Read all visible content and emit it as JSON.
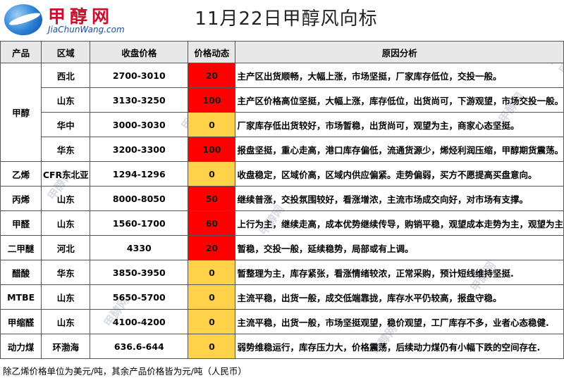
{
  "brand": {
    "name_cn": "甲醇网",
    "domain": "JiaChunWang.com"
  },
  "title": "11月22日甲醇风向标",
  "table": {
    "headers": [
      "产品",
      "区域",
      "收盘价格",
      "价格动态",
      "原因分析"
    ],
    "groups": [
      {
        "product": "甲醇",
        "rows": [
          {
            "region": "西北",
            "price": "2700-3010",
            "change": "20",
            "status": "up",
            "reason": "主产区出货顺畅，大幅上涨，市场坚挺，厂家库存低位，交投一般。"
          },
          {
            "region": "山东",
            "price": "3130-3250",
            "change": "100",
            "status": "up",
            "reason": "主产区价格高位坚挺，大幅上涨，库存低位，出货尚可，下游观望，市场交投一般。"
          },
          {
            "region": "华中",
            "price": "3000-3030",
            "change": "0",
            "status": "flat",
            "reason": "厂家库存低出货较好，市场暂稳，出货尚可，观望为主，商家心态坚挺。"
          },
          {
            "region": "华东",
            "price": "3200-3300",
            "change": "100",
            "status": "up",
            "reason": "报盘坚挺，重心走高，港口库存偏低，流通货源少，烯烃利润压缩，甲醇期货震荡。"
          }
        ]
      },
      {
        "product": "乙烯",
        "rows": [
          {
            "region": "CFR东北亚",
            "price": "1294-1296",
            "change": "0",
            "status": "flat",
            "reason": "收盘稳定，区域价高，区域内供应偏紧。走势偏弱，买方不愿提高买盘意向。"
          }
        ]
      },
      {
        "product": "丙烯",
        "rows": [
          {
            "region": "山东",
            "price": "8000-8050",
            "change": "50",
            "status": "up",
            "reason": "继续普涨，交投氛围较好，看涨增浓，主流市场成交向好，对市场有支撑。"
          }
        ]
      },
      {
        "product": "甲醛",
        "rows": [
          {
            "region": "山东",
            "price": "1560-1700",
            "change": "60",
            "status": "up",
            "reason": "上行为主，继续走高，成本优势继续传导，购销平稳，观望成本走势为主，观望为主"
          }
        ]
      },
      {
        "product": "二甲醚",
        "rows": [
          {
            "region": "河北",
            "price": "4330",
            "change": "20",
            "status": "up",
            "reason": "暂稳，交投一般，延续稳势，局部或有上调。"
          }
        ]
      },
      {
        "product": "醋酸",
        "rows": [
          {
            "region": "华东",
            "price": "3850-3950",
            "change": "0",
            "status": "flat",
            "reason": "暂整理为主，库存紧张，看涨情绪较浓，正常采购，预计短线维持坚挺."
          }
        ]
      },
      {
        "product": "MTBE",
        "rows": [
          {
            "region": "山东",
            "price": "5650-5700",
            "change": "0",
            "status": "flat",
            "reason": "主流平稳，出货一般，成交低端靠拢，库存水平仍较高，报盘守稳。"
          }
        ]
      },
      {
        "product": "甲缩醛",
        "rows": [
          {
            "region": "山东",
            "price": "4100-4200",
            "change": "0",
            "status": "flat",
            "reason": "主流平稳，出货一般，市场坚挺观望，稳价观望，工厂库存不多，业者心态稳健."
          }
        ]
      },
      {
        "product": "动力煤",
        "rows": [
          {
            "region": "环渤海",
            "price": "636.6-644",
            "change": "0",
            "status": "flat",
            "reason": "弱势维稳运行，库存压力大，价格震荡，后续动力煤仍有小幅下跌的空间存在."
          }
        ]
      }
    ]
  },
  "footer": {
    "note": "除乙烯价格单位为美元/吨，其余产品价格皆为元/吨（人民币）"
  },
  "colors": {
    "up": "#ff0000",
    "flat": "#ffd24a",
    "header_bg": "#e8e8e8"
  },
  "icons": [
    "globe-logo-icon"
  ]
}
